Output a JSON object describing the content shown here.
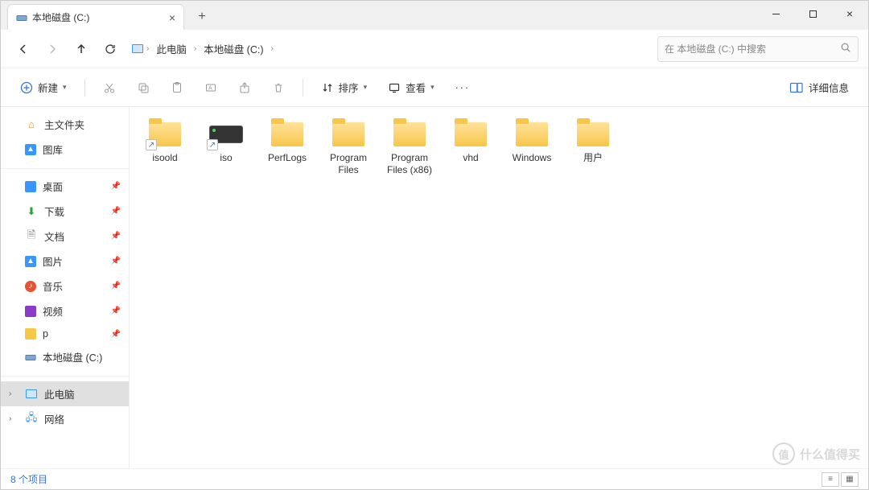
{
  "tab": {
    "title": "本地磁盘 (C:)"
  },
  "breadcrumb": {
    "pc": "此电脑",
    "drive": "本地磁盘 (C:)"
  },
  "search": {
    "placeholder": "在 本地磁盘 (C:) 中搜索"
  },
  "toolbar": {
    "new": "新建",
    "sort": "排序",
    "view": "查看",
    "details": "详细信息"
  },
  "sidebar": {
    "top": [
      {
        "id": "home",
        "label": "主文件夹"
      },
      {
        "id": "gallery",
        "label": "图库"
      }
    ],
    "pinned": [
      {
        "id": "desktop",
        "label": "桌面"
      },
      {
        "id": "downloads",
        "label": "下载"
      },
      {
        "id": "documents",
        "label": "文档"
      },
      {
        "id": "pictures",
        "label": "图片"
      },
      {
        "id": "music",
        "label": "音乐"
      },
      {
        "id": "videos",
        "label": "视频"
      },
      {
        "id": "p",
        "label": "p"
      },
      {
        "id": "cdrive",
        "label": "本地磁盘 (C:)"
      }
    ],
    "bottom": [
      {
        "id": "thispc",
        "label": "此电脑"
      },
      {
        "id": "network",
        "label": "网络"
      }
    ]
  },
  "items": [
    {
      "name": "isoold",
      "type": "folder",
      "shortcut": true
    },
    {
      "name": "iso",
      "type": "drive",
      "shortcut": true
    },
    {
      "name": "PerfLogs",
      "type": "folder",
      "shortcut": false
    },
    {
      "name": "Program Files",
      "type": "folder",
      "shortcut": false
    },
    {
      "name": "Program Files (x86)",
      "type": "folder",
      "shortcut": false
    },
    {
      "name": "vhd",
      "type": "folder",
      "shortcut": false
    },
    {
      "name": "Windows",
      "type": "folder",
      "shortcut": false
    },
    {
      "name": "用户",
      "type": "folder",
      "shortcut": false
    }
  ],
  "status": {
    "count": "8 个项目"
  },
  "watermark": "什么值得买"
}
